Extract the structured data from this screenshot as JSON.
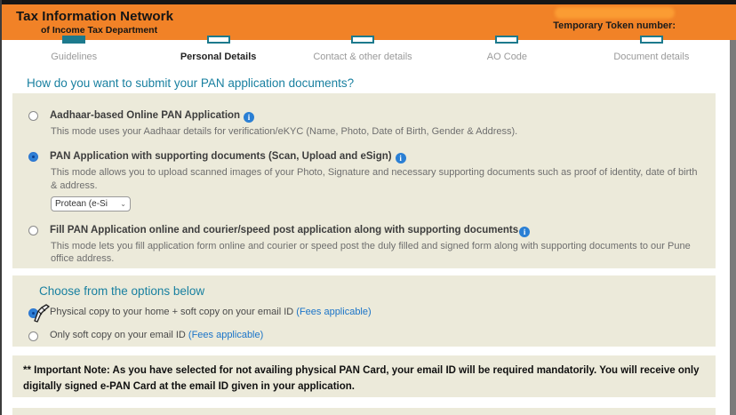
{
  "header": {
    "title_line1": "Tax Information Network",
    "title_line2": "of Income Tax Department",
    "token_label": "Temporary Token number:"
  },
  "stepper": {
    "steps": [
      {
        "label": "Guidelines",
        "state": "done"
      },
      {
        "label": "Personal Details",
        "state": "active"
      },
      {
        "label": "Contact & other details",
        "state": "upcoming"
      },
      {
        "label": "AO Code",
        "state": "upcoming"
      },
      {
        "label": "Document details",
        "state": "upcoming"
      }
    ]
  },
  "question": "How do you want to submit your PAN application documents?",
  "submit_options": [
    {
      "label": "Aadhaar-based Online PAN Application",
      "desc": "This mode uses your Aadhaar details for verification/eKYC (Name, Photo, Date of Birth, Gender & Address).",
      "selected": false,
      "info_icon": "info-icon"
    },
    {
      "label": "PAN Application with supporting documents (Scan, Upload and eSign)",
      "desc": "This mode allows you to upload scanned images of your Photo, Signature and necessary supporting documents such as proof of identity, date of birth & address.",
      "selected": true,
      "info_icon": "info-icon",
      "dropdown_value": "Protean (e-Si"
    },
    {
      "label": "Fill PAN Application online and courier/speed post application along with supporting documents",
      "desc": "This mode lets you fill application form online and courier or speed post the duly filled and signed form along with supporting documents to our Pune office address.",
      "selected": false,
      "info_icon": "info-icon"
    }
  ],
  "delivery": {
    "heading": "Choose from the options below",
    "options": [
      {
        "label": "Physical copy to your home + soft copy on your email ID ",
        "fees": "(Fees applicable)",
        "selected": true
      },
      {
        "label": "Only soft copy on your email ID ",
        "fees": "(Fees applicable)",
        "selected": false
      }
    ]
  },
  "note": "** Important Note: As you have selected for not availing physical PAN Card, your email ID will be required mandatorily. You will receive only digitally signed e-PAN Card at the email ID given in your application.",
  "colors": {
    "header_orange": "#F18227",
    "redaction_orange": "#FB9C33",
    "panel_beige": "#ECEADA",
    "step_teal": "#1D7A8D",
    "heading_teal": "#1980A0",
    "link_blue": "#1B74C8",
    "info_blue": "#2A7FD4",
    "radio_selected_blue": "#2F80D6"
  }
}
